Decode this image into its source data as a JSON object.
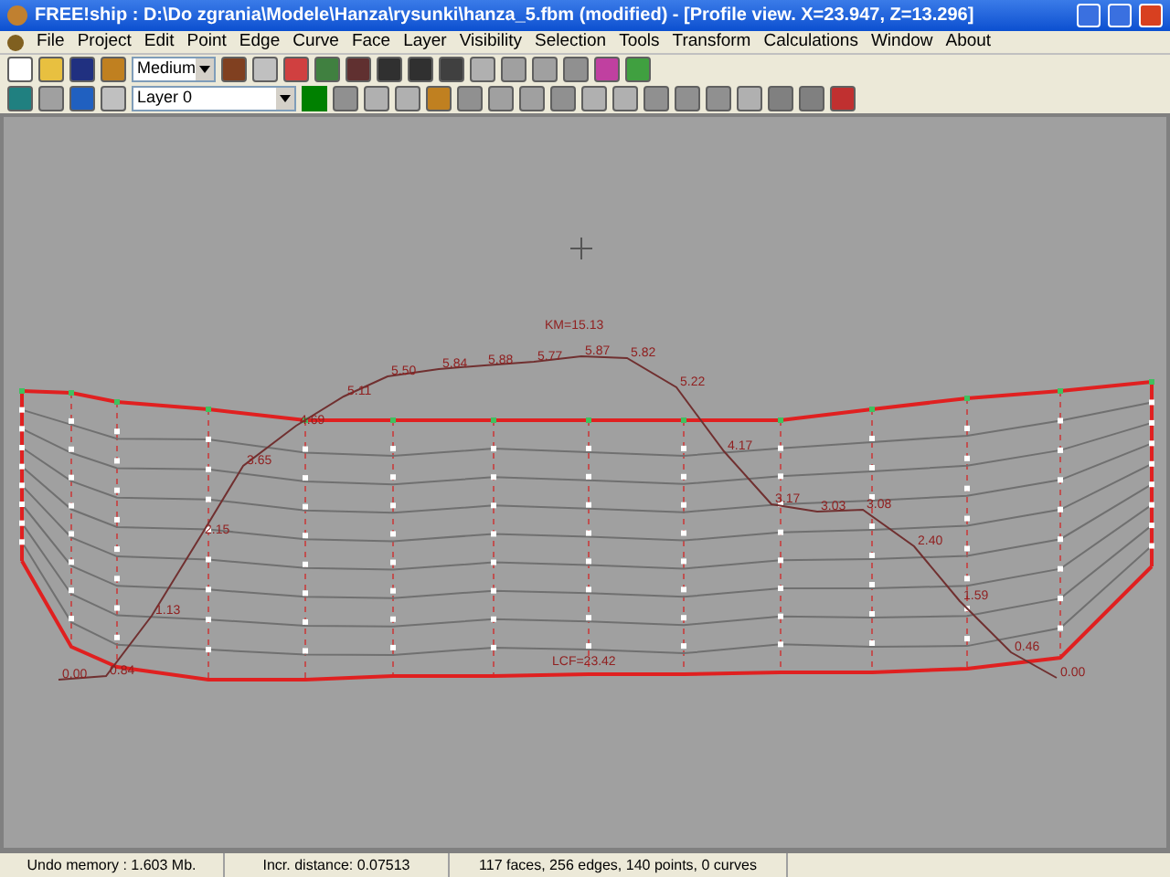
{
  "window": {
    "title": "FREE!ship    : D:\\Do zgrania\\Modele\\Hanza\\rysunki\\hanza_5.fbm (modified) - [Profile view.  X=23.947,  Z=13.296]"
  },
  "menu": [
    "File",
    "Project",
    "Edit",
    "Point",
    "Edge",
    "Curve",
    "Face",
    "Layer",
    "Visibility",
    "Selection",
    "Tools",
    "Transform",
    "Calculations",
    "Window",
    "About"
  ],
  "toolbar": {
    "precision": "Medium",
    "layer": "Layer 0",
    "layer_swatch": {
      "color": "#008000"
    }
  },
  "canvas": {
    "km_label": "KM=15.13",
    "lcf_label": "LCF=23.42",
    "curve_labels": [
      "0.00",
      "0.84",
      "1.13",
      "2.15",
      "3.65",
      "4.69",
      "5.11",
      "5.50",
      "5.84",
      "5.88",
      "5.77",
      "5.87",
      "5.82",
      "5.22",
      "4.17",
      "3.17",
      "3.03",
      "3.08",
      "2.40",
      "1.59",
      "0.46",
      "0.00"
    ]
  },
  "status_bar": [
    "Undo memory : 1.603 Mb.",
    "Incr. distance: 0.07513",
    "117 faces, 256 edges, 140 points, 0 curves"
  ]
}
